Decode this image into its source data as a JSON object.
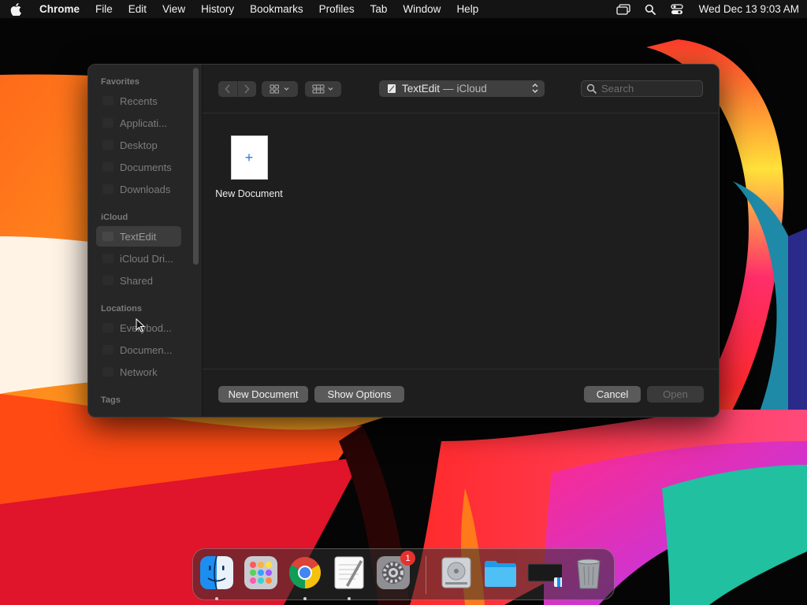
{
  "menubar": {
    "app_name": "Chrome",
    "items": [
      "File",
      "Edit",
      "View",
      "History",
      "Bookmarks",
      "Profiles",
      "Tab",
      "Window",
      "Help"
    ],
    "clock": "Wed Dec 13  9:03 AM",
    "status_icons": [
      "display-icon",
      "search-icon",
      "control-center-icon"
    ]
  },
  "dialog": {
    "sidebar": {
      "sections": [
        {
          "title": "Favorites",
          "items": [
            "Recents",
            "Applicati...",
            "Desktop",
            "Documents",
            "Downloads"
          ]
        },
        {
          "title": "iCloud",
          "items": [
            "TextEdit",
            "iCloud Dri...",
            "Shared"
          ]
        },
        {
          "title": "Locations",
          "items": [
            "Everybod...",
            "Documen...",
            "Network"
          ]
        },
        {
          "title": "Tags",
          "items": []
        }
      ],
      "selected": "TextEdit"
    },
    "toolbar": {
      "location_app": "TextEdit",
      "location_separator": "—",
      "location_place": "iCloud",
      "search_placeholder": "Search"
    },
    "files": [
      {
        "name": "New Document",
        "thumb_symbol": "+"
      }
    ],
    "buttons": {
      "new_document": "New Document",
      "show_options": "Show Options",
      "cancel": "Cancel",
      "open": "Open"
    }
  },
  "dock": {
    "apps": [
      "Finder",
      "Launchpad",
      "Google Chrome",
      "TextEdit",
      "System Settings",
      "Disk Utility",
      "Folder",
      "Screen Sharing",
      "Trash"
    ],
    "settings_badge": "1"
  },
  "colors": {
    "accent_blue": "#2f7bd9",
    "badge_red": "#e5322d",
    "dialog_bg": "#1f1f1f",
    "sidebar_bg": "#262626"
  }
}
